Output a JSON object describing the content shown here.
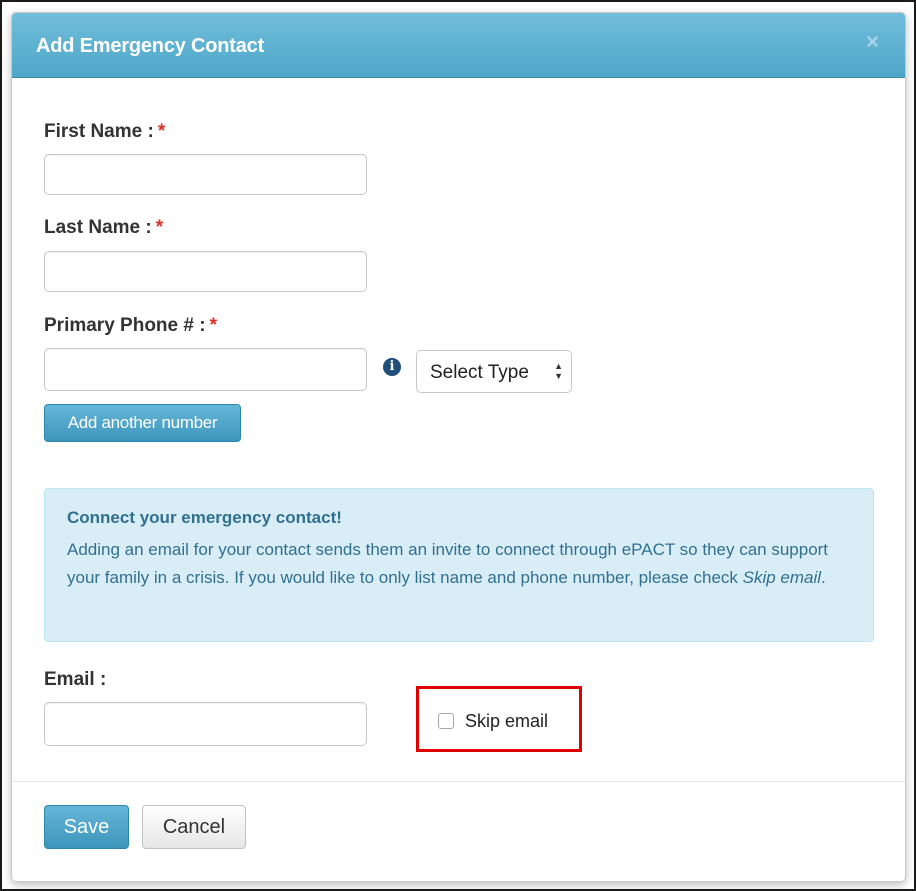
{
  "modal": {
    "title": "Add Emergency Contact",
    "close_icon": "×"
  },
  "form": {
    "first_name": {
      "label": "First Name :",
      "required_mark": "*",
      "value": ""
    },
    "last_name": {
      "label": "Last Name :",
      "required_mark": "*",
      "value": ""
    },
    "primary_phone": {
      "label": "Primary Phone # :",
      "required_mark": "*",
      "value": "",
      "info_icon": "i",
      "type_select": {
        "selected": "Select Type"
      }
    },
    "add_number_label": "Add another number",
    "email": {
      "label": "Email :",
      "value": ""
    },
    "skip_email": {
      "label": "Skip email",
      "checked": false
    }
  },
  "notice": {
    "title": "Connect your emergency contact!",
    "body": "Adding an email for your contact sends them an invite to connect through ePACT so they can support your family in a crisis. If you would like to only list name and phone number, please check ",
    "body_emphasis": "Skip email",
    "body_end": "."
  },
  "footer": {
    "save_label": "Save",
    "cancel_label": "Cancel"
  },
  "colors": {
    "header_bg": "#4ea6c8",
    "primary_button": "#3d96bd",
    "required": "#d9312b",
    "notice_bg": "#d9edf7",
    "notice_text": "#31708f",
    "highlight": "#e00000"
  }
}
